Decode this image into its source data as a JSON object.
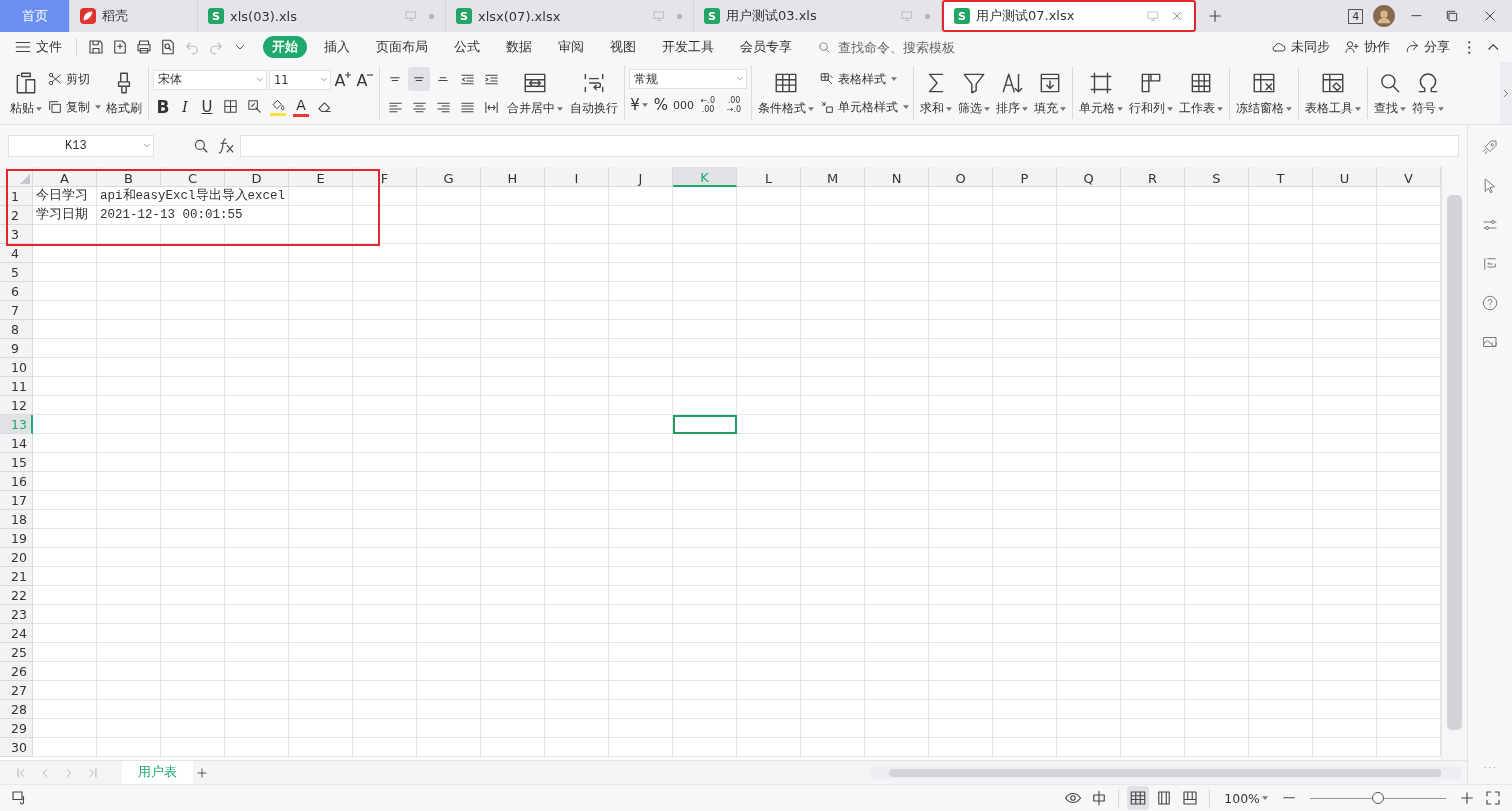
{
  "tabs": [
    {
      "label": "首页",
      "kind": "home",
      "selected": false
    },
    {
      "label": "稻壳",
      "kind": "docer",
      "selected": false
    },
    {
      "label": "xls(03).xls",
      "kind": "sheet",
      "logo": "S",
      "selected": false
    },
    {
      "label": "xlsx(07).xlsx",
      "kind": "sheet",
      "logo": "S",
      "selected": false
    },
    {
      "label": "用户测试03.xls",
      "kind": "sheet",
      "logo": "S",
      "selected": false
    },
    {
      "label": "用户测试07.xlsx",
      "kind": "sheet",
      "logo": "S",
      "selected": true
    }
  ],
  "window_count": "4",
  "menu": {
    "file": "文件",
    "tabs": [
      {
        "label": "开始",
        "selected": true
      },
      {
        "label": "插入",
        "selected": false
      },
      {
        "label": "页面布局",
        "selected": false
      },
      {
        "label": "公式",
        "selected": false
      },
      {
        "label": "数据",
        "selected": false
      },
      {
        "label": "审阅",
        "selected": false
      },
      {
        "label": "视图",
        "selected": false
      },
      {
        "label": "开发工具",
        "selected": false
      },
      {
        "label": "会员专享",
        "selected": false
      }
    ],
    "search": {
      "placeholder": "查找命令、搜索模板"
    },
    "actions": [
      "未同步",
      "协作",
      "分享"
    ]
  },
  "ribbon": {
    "paste": "粘贴",
    "cut": "剪切",
    "copy": "复制",
    "format_painter": "格式刷",
    "font": "宋体",
    "font_size": "11",
    "grow_font": "A",
    "shrink_font": "A",
    "bold": "B",
    "italic": "I",
    "underline": "U",
    "font_color": "A",
    "merge": "合并居中",
    "wrap": "自动换行",
    "number_format": "常规",
    "currency": "¥",
    "percent": "%",
    "thousands": "000",
    "decimals": [
      {
        "top": "←.0",
        "bottom": ".00"
      },
      {
        "top": ".00",
        "bottom": "→.0"
      }
    ],
    "conditional_format": "条件格式",
    "table_style": "表格样式",
    "cell_style": "单元格样式",
    "tools": [
      {
        "label": "求和"
      },
      {
        "label": "筛选"
      },
      {
        "label": "排序"
      },
      {
        "label": "填充"
      },
      {
        "label": "单元格"
      },
      {
        "label": "行和列"
      },
      {
        "label": "工作表"
      },
      {
        "label": "冻结窗格"
      },
      {
        "label": "表格工具"
      },
      {
        "label": "查找"
      },
      {
        "label": "符号"
      }
    ]
  },
  "name_box": "K13",
  "grid": {
    "columns": [
      {
        "label": "A",
        "selected": false
      },
      {
        "label": "B",
        "selected": false
      },
      {
        "label": "C",
        "selected": false
      },
      {
        "label": "D",
        "selected": false
      },
      {
        "label": "E",
        "selected": false
      },
      {
        "label": "F",
        "selected": false
      },
      {
        "label": "G",
        "selected": false
      },
      {
        "label": "H",
        "selected": false
      },
      {
        "label": "I",
        "selected": false
      },
      {
        "label": "J",
        "selected": false
      },
      {
        "label": "K",
        "selected": true
      },
      {
        "label": "L",
        "selected": false
      },
      {
        "label": "M",
        "selected": false
      },
      {
        "label": "N",
        "selected": false
      },
      {
        "label": "O",
        "selected": false
      },
      {
        "label": "P",
        "selected": false
      },
      {
        "label": "Q",
        "selected": false
      },
      {
        "label": "R",
        "selected": false
      },
      {
        "label": "S",
        "selected": false
      },
      {
        "label": "T",
        "selected": false
      },
      {
        "label": "U",
        "selected": false
      },
      {
        "label": "V",
        "selected": false
      }
    ],
    "rows": [
      {
        "label": "1",
        "selected": false,
        "cells": [
          "今日学习",
          "api和easyExcl导出导入excel"
        ]
      },
      {
        "label": "2",
        "selected": false,
        "cells": [
          "学习日期",
          "2021-12-13 00:01:55"
        ]
      },
      {
        "label": "3",
        "selected": false
      },
      {
        "label": "4",
        "selected": false
      },
      {
        "label": "5",
        "selected": false
      },
      {
        "label": "6",
        "selected": false
      },
      {
        "label": "7",
        "selected": false
      },
      {
        "label": "8",
        "selected": false
      },
      {
        "label": "9",
        "selected": false
      },
      {
        "label": "10",
        "selected": false
      },
      {
        "label": "11",
        "selected": false
      },
      {
        "label": "12",
        "selected": false
      },
      {
        "label": "13",
        "selected": true
      },
      {
        "label": "14",
        "selected": false
      },
      {
        "label": "15",
        "selected": false
      },
      {
        "label": "16",
        "selected": false
      },
      {
        "label": "17",
        "selected": false
      },
      {
        "label": "18",
        "selected": false
      },
      {
        "label": "19",
        "selected": false
      },
      {
        "label": "20",
        "selected": false
      },
      {
        "label": "21",
        "selected": false
      },
      {
        "label": "22",
        "selected": false
      },
      {
        "label": "23",
        "selected": false
      },
      {
        "label": "24",
        "selected": false
      },
      {
        "label": "25",
        "selected": false
      },
      {
        "label": "26",
        "selected": false
      },
      {
        "label": "27",
        "selected": false
      },
      {
        "label": "28",
        "selected": false
      },
      {
        "label": "29",
        "selected": false
      },
      {
        "label": "30",
        "selected": false
      }
    ]
  },
  "sheets": [
    {
      "label": "用户表",
      "selected": true
    }
  ],
  "status": {
    "zoom": "100%",
    "zoom_slider": {
      "level": 0.5
    }
  }
}
